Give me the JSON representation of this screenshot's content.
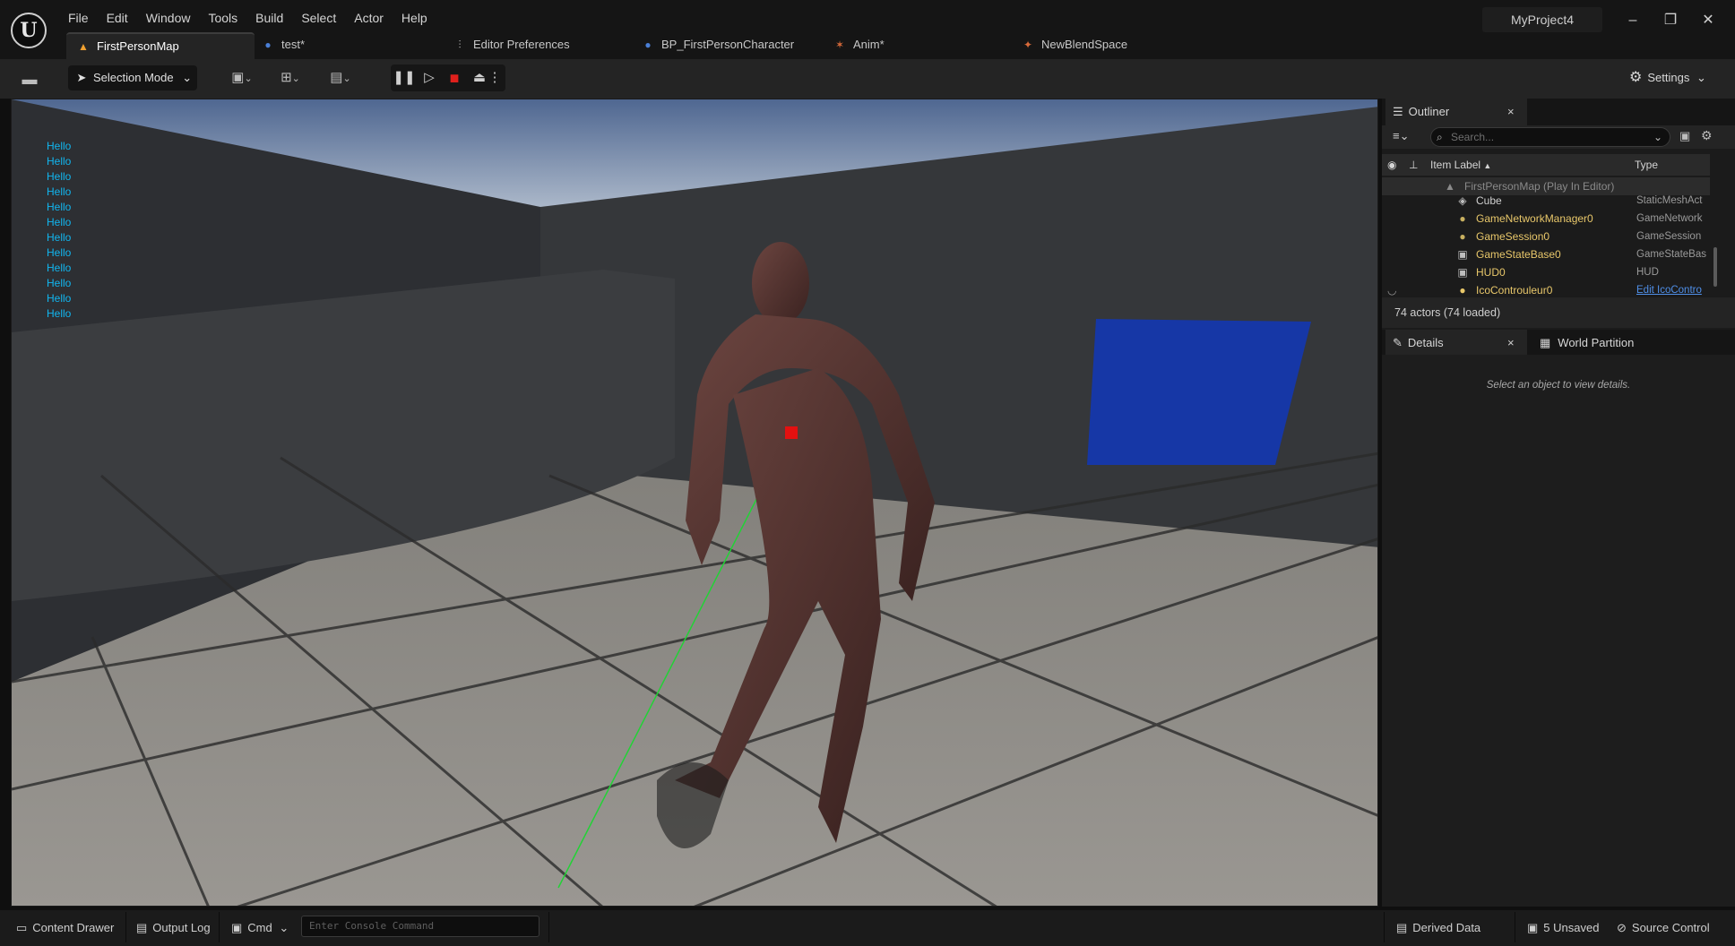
{
  "app": {
    "project_name": "MyProject4",
    "logo_glyph": "U"
  },
  "menu": [
    "File",
    "Edit",
    "Window",
    "Tools",
    "Build",
    "Select",
    "Actor",
    "Help"
  ],
  "window_controls": {
    "minimize": "–",
    "restore": "❐",
    "close": "✕"
  },
  "tabs": [
    {
      "label": "FirstPersonMap",
      "icon": "map-icon",
      "glyph": "▲",
      "color": "#f0a030"
    },
    {
      "label": "test*",
      "icon": "blueprint-icon",
      "glyph": "●",
      "color": "#4a7fd6"
    },
    {
      "label": "Editor Preferences",
      "icon": "preferences-icon",
      "glyph": "⫶",
      "color": "#bbbbbb"
    },
    {
      "label": "BP_FirstPersonCharacter",
      "icon": "character-icon",
      "glyph": "●",
      "color": "#4a7fd6"
    },
    {
      "label": "Anim*",
      "icon": "anim-icon",
      "glyph": "✶",
      "color": "#d86a3a"
    },
    {
      "label": "NewBlendSpace",
      "icon": "blendspace-icon",
      "glyph": "✦",
      "color": "#d86a3a"
    }
  ],
  "toolbar": {
    "mode_label": "Selection Mode",
    "settings_label": "Settings",
    "chevron": "⌄",
    "play": {
      "pause": "❚❚",
      "step": "▷",
      "stop": "■",
      "eject": "⏏",
      "more": "⋮"
    }
  },
  "viewport": {
    "hello_lines": [
      "Hello",
      "Hello",
      "Hello",
      "Hello",
      "Hello",
      "Hello",
      "Hello",
      "Hello",
      "Hello",
      "Hello",
      "Hello",
      "Hello"
    ]
  },
  "outliner": {
    "tab_label": "Outliner",
    "close_glyph": "×",
    "search_placeholder": "Search...",
    "columns": {
      "label": "Item Label",
      "sort": "▲",
      "type": "Type"
    },
    "root_label": "FirstPersonMap (Play In Editor)",
    "rows": [
      {
        "label": "Cube",
        "type": "StaticMeshAct",
        "glyph": "◈"
      },
      {
        "label": "GameNetworkManager0",
        "type": "GameNetwork",
        "glyph": "●"
      },
      {
        "label": "GameSession0",
        "type": "GameSession",
        "glyph": "●"
      },
      {
        "label": "GameStateBase0",
        "type": "GameStateBas",
        "glyph": "▣"
      },
      {
        "label": "HUD0",
        "type": "HUD",
        "glyph": "▣"
      },
      {
        "label": "IcoControuleur0",
        "type": "Edit IcoContro",
        "glyph": "●"
      }
    ],
    "actor_count": "74 actors (74 loaded)"
  },
  "details": {
    "tab_label": "Details",
    "world_partition_label": "World Partition",
    "empty_message": "Select an object to view details."
  },
  "statusbar": {
    "content_drawer": "Content Drawer",
    "output_log": "Output Log",
    "cmd": "Cmd",
    "console_placeholder": "Enter Console Command",
    "derived_data": "Derived Data",
    "unsaved": "5 Unsaved",
    "source_control": "Source Control"
  }
}
